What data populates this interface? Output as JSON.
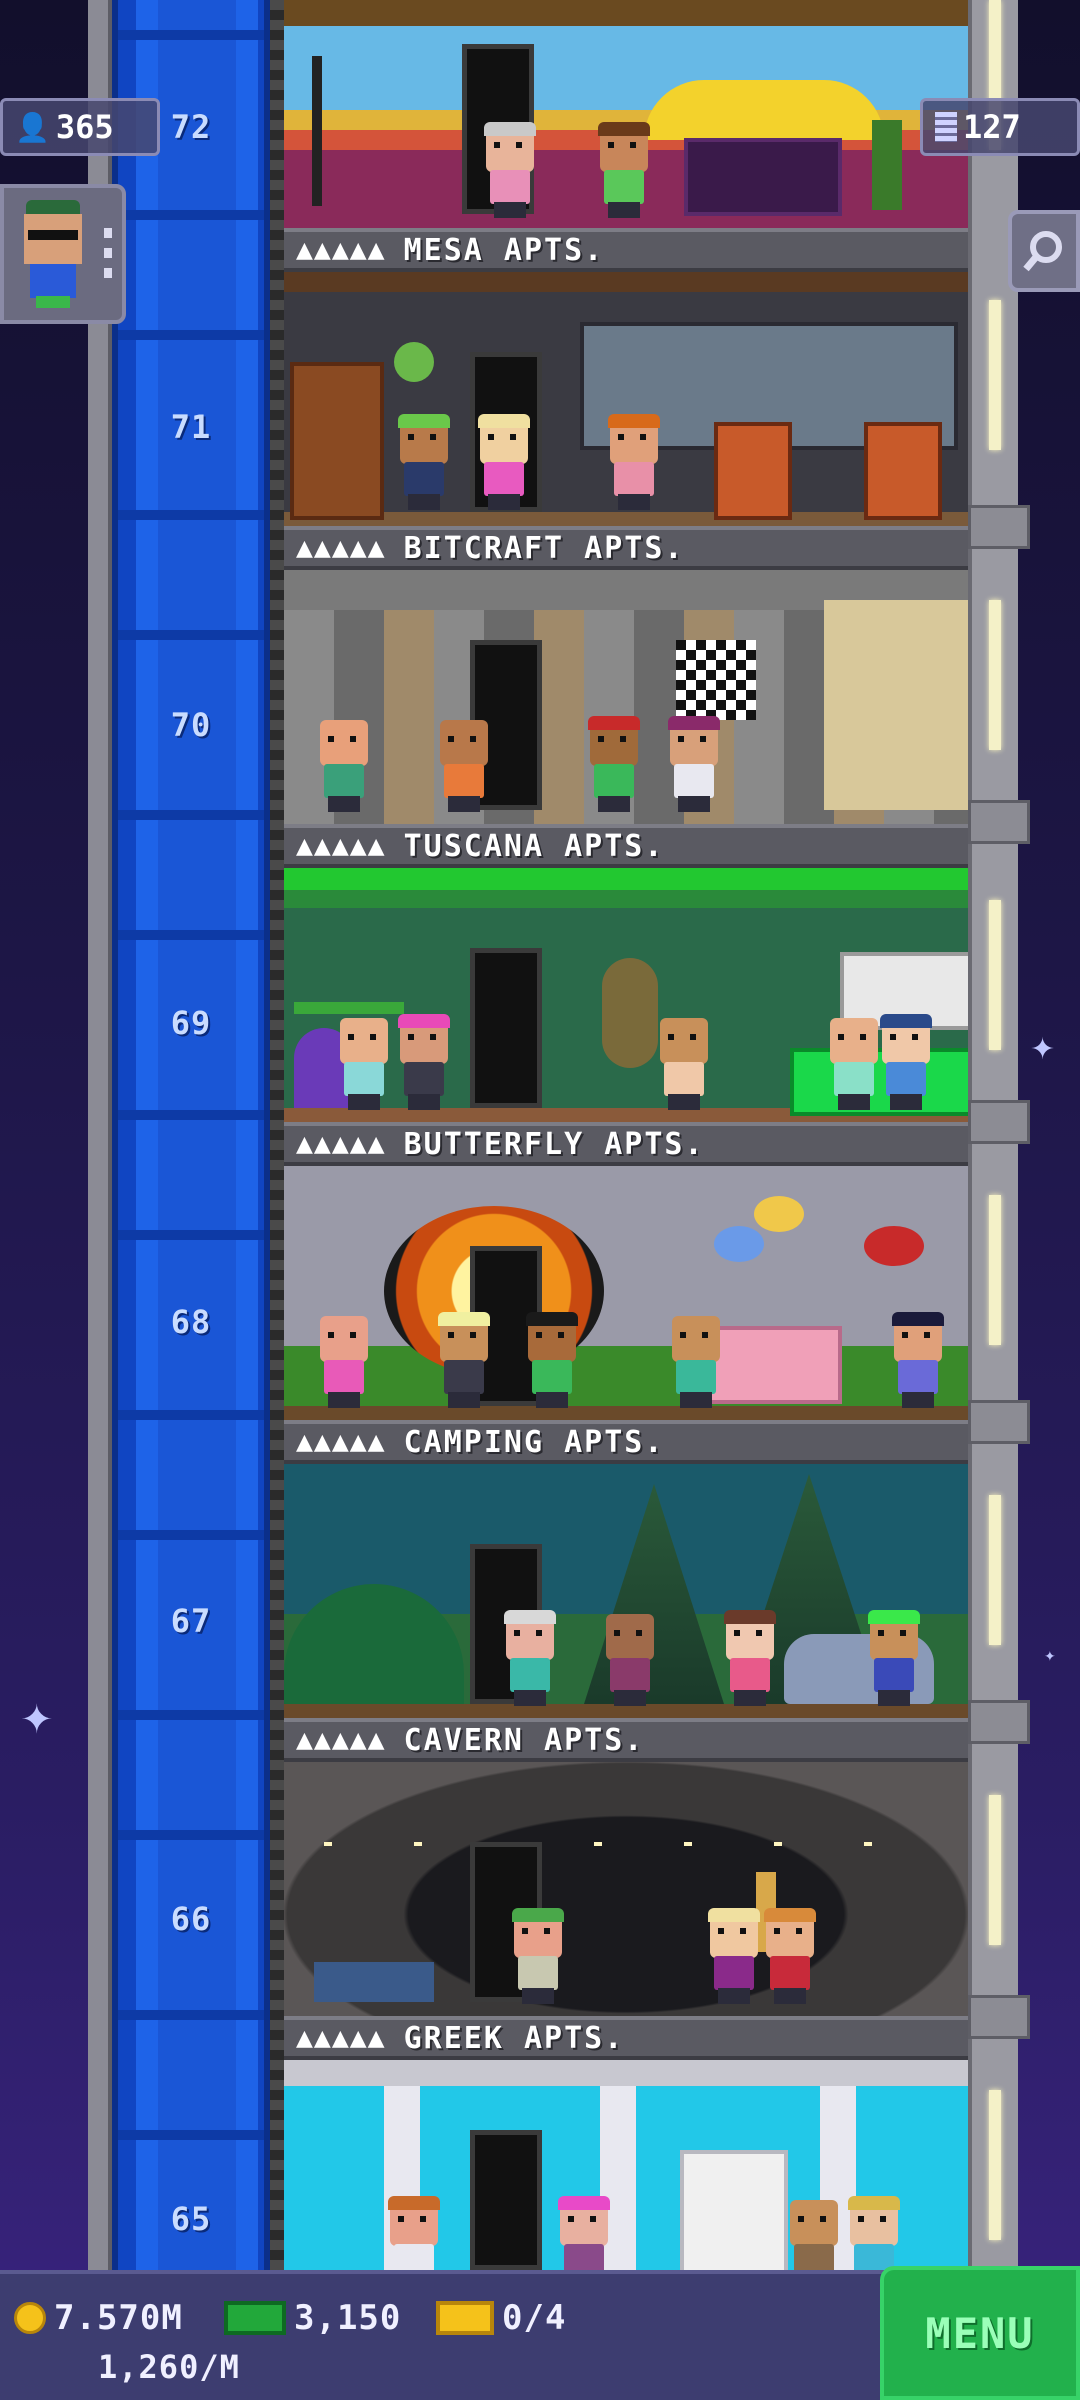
{
  "hud": {
    "population": "365",
    "population_icon": "person-icon",
    "bux_count": "127",
    "bux_icon": "building-icon"
  },
  "floors": [
    {
      "number": "72",
      "name": "MESA APTS.",
      "stars": "▲▲▲▲▲"
    },
    {
      "number": "71",
      "name": "BITCRAFT APTS.",
      "stars": "▲▲▲▲▲"
    },
    {
      "number": "70",
      "name": "TUSCANA APTS.",
      "stars": "▲▲▲▲▲"
    },
    {
      "number": "69",
      "name": "BUTTERFLY APTS.",
      "stars": "▲▲▲▲▲"
    },
    {
      "number": "68",
      "name": "CAMPING APTS.",
      "stars": "▲▲▲▲▲"
    },
    {
      "number": "67",
      "name": "CAVERN APTS.",
      "stars": "▲▲▲▲▲"
    },
    {
      "number": "66",
      "name": "GREEK APTS.",
      "stars": "▲▲▲▲▲"
    },
    {
      "number": "65",
      "name": "",
      "stars": ""
    }
  ],
  "bottom_bar": {
    "coins": "7.570M",
    "coins_rate": "1,260/M",
    "bux": "3,150",
    "tickets": "0/4",
    "menu_label": "MENU"
  },
  "colors": {
    "shaft_blue": "#1a56d6",
    "menu_green": "#22b14c",
    "hud_panel": "#3d3d70"
  }
}
